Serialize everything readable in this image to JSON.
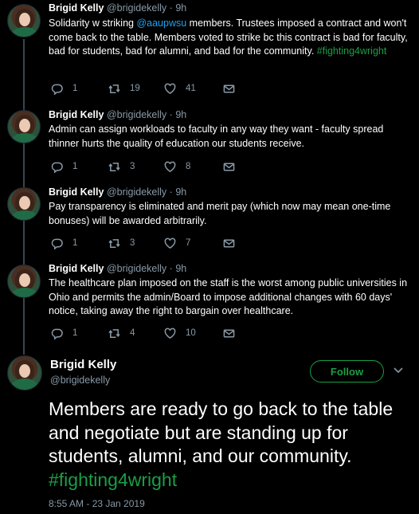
{
  "tweets": [
    {
      "name": "Brigid Kelly",
      "handle": "@brigidekelly",
      "time": "9h",
      "text_before": "Solidarity w striking ",
      "mention": "@aaupwsu",
      "text_after": " members. Trustees imposed a contract and won't come back to the table. Members voted to strike bc this contract is bad for faculty, bad for students, bad for alumni, and bad for the community. ",
      "hashtag": "#fighting4wright",
      "replies": "1",
      "retweets": "19",
      "likes": "41"
    },
    {
      "name": "Brigid Kelly",
      "handle": "@brigidekelly",
      "time": "9h",
      "text": "Admin can assign workloads to faculty in any way they want - faculty spread thinner hurts the quality of education our students receive.",
      "replies": "1",
      "retweets": "3",
      "likes": "8"
    },
    {
      "name": "Brigid Kelly",
      "handle": "@brigidekelly",
      "time": "9h",
      "text": "Pay transparency is eliminated and merit pay (which now may mean one-time bonuses) will be awarded arbitrarily.",
      "replies": "1",
      "retweets": "3",
      "likes": "7"
    },
    {
      "name": "Brigid Kelly",
      "handle": "@brigidekelly",
      "time": "9h",
      "text": "The healthcare plan imposed on the staff is the worst among public universities in Ohio and permits the admin/Board to impose additional changes with 60 days' notice, taking away the right to bargain over healthcare.",
      "replies": "1",
      "retweets": "4",
      "likes": "10"
    }
  ],
  "main": {
    "name": "Brigid Kelly",
    "handle": "@brigidekelly",
    "follow_label": "Follow",
    "text": "Members are ready to go back to the table and negotiate but are standing up for students, alumni, and our community. ",
    "hashtag": "#fighting4wright",
    "timestamp": "8:55 AM - 23 Jan 2019"
  },
  "colors": {
    "background": "#000000",
    "accent": "#1b9e46",
    "mention": "#1da1f2",
    "muted": "#8899a6"
  },
  "icons": [
    "reply-icon",
    "retweet-icon",
    "like-icon",
    "message-icon",
    "chevron-down-icon"
  ]
}
